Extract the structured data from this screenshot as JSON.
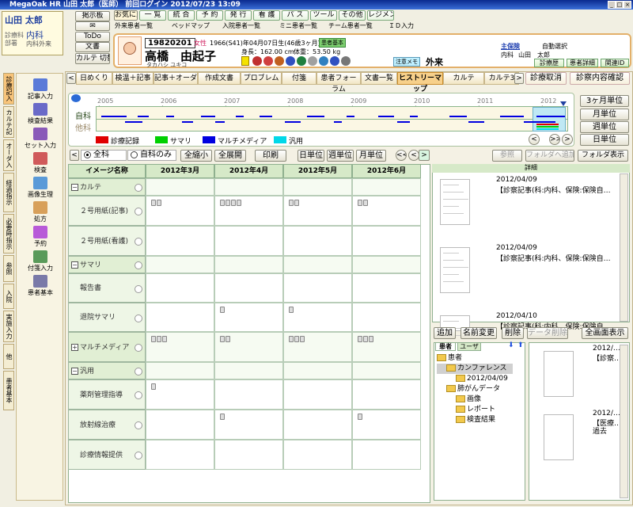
{
  "window": {
    "title": "MegaOak HR   山田 太郎（医師） 前回ログイン 2012/07/23 13:09"
  },
  "user": {
    "name": "山田 太郎",
    "role_label": "診療科",
    "role_value": "内科",
    "dept_label": "部署",
    "dept_value": "内科外来"
  },
  "top_buttons": {
    "board": "掲示板",
    "mail": "✉",
    "todo": "ToDo",
    "docs": "文書",
    "card_switch": "カルテ 切替"
  },
  "menu_tabs": [
    "お気に入",
    "一 覧",
    "統 合",
    "予 約",
    "発 行",
    "看 護",
    "パ ス",
    "ツール",
    "その他",
    "レジメン"
  ],
  "quick_links": [
    "外来患者一覧",
    "ベッドマップ",
    "入院患者一覧",
    "ミニ患者一覧",
    "チーム患者一覧",
    "ＩＤ入力"
  ],
  "patient": {
    "id": "19820201",
    "sex": "女性",
    "dob": "1966(S41)年04月07日生(46歳3ヶ月)",
    "badge": "患者基本",
    "name": "高橋　由起子",
    "kana": "タカハシ ユキコ",
    "height": "身長：162.00 cm",
    "weight": "体重：53.50 kg",
    "memo_label": "注意メモ",
    "visit": "外来"
  },
  "insurance": {
    "main": "主保険",
    "auto": "自動選択",
    "dept": "内科",
    "doctor": "山田　太郎",
    "btn_history": "診療歴",
    "btn_detail": "患者詳細",
    "btn_related": "関連ID"
  },
  "doc_tabs": [
    "日めくり",
    "検温＋記事",
    "記事＋オーダ",
    "作成文書",
    "プロブレム",
    "付箋",
    "患者フォーラム",
    "文書一覧",
    "ヒストリーマップ",
    "カルテ",
    "カルテ3"
  ],
  "doc_actions": {
    "cancel": "診療取消",
    "confirm": "診察内容確認"
  },
  "left_tabs": [
    "診療記入",
    "カルテ記事",
    "オーダ入力",
    "経過指示",
    "必要時指示",
    "参照",
    "入院",
    "実施入力",
    "他",
    "患者基本"
  ],
  "tools": [
    "記事入力",
    "検査結果",
    "セット入力",
    "検査",
    "画像生理",
    "処方",
    "予約",
    "付箋入力",
    "患者基本"
  ],
  "timeline": {
    "years": [
      "2005年",
      "2006年",
      "2007年",
      "2008年",
      "2009年",
      "2010年",
      "2011年",
      "2012年"
    ],
    "row_self": "自科",
    "row_other": "他科",
    "units": [
      "3ヶ月単位",
      "月単位",
      "週単位",
      "日単位"
    ]
  },
  "legend": [
    {
      "label": "診療記録",
      "color": "#e00000"
    },
    {
      "label": "サマリ",
      "color": "#00d000"
    },
    {
      "label": "マルチメディア",
      "color": "#0000e0"
    },
    {
      "label": "汎用",
      "color": "#00d8e8"
    }
  ],
  "filter": {
    "all": "全科",
    "self": "自科のみ",
    "collapse": "全縮小",
    "expand": "全展開",
    "print": "印刷",
    "day": "日単位",
    "week": "週単位",
    "month": "月単位"
  },
  "right_top": {
    "ref": "参照",
    "add_folder": "フォルダへ追加",
    "show_folder": "フォルダ表示",
    "detail": "詳細"
  },
  "grid": {
    "header_name": "イメージ名称",
    "months": [
      "2012年3月",
      "2012年4月",
      "2012年5月",
      "2012年6月"
    ],
    "rows": [
      {
        "label": "カルテ",
        "group": true,
        "mark": "−"
      },
      {
        "label": "２号用紙(記事)",
        "group": false
      },
      {
        "label": "２号用紙(看護)",
        "group": false
      },
      {
        "label": "サマリ",
        "group": true,
        "mark": "−"
      },
      {
        "label": "報告書",
        "group": false
      },
      {
        "label": "退院サマリ",
        "group": false
      },
      {
        "label": "マルチメディア",
        "group": true,
        "mark": "+"
      },
      {
        "label": "汎用",
        "group": true,
        "mark": "−"
      },
      {
        "label": "薬剤管理指導",
        "group": false
      },
      {
        "label": "放射線治療",
        "group": false
      },
      {
        "label": "診療情報提供",
        "group": false
      }
    ]
  },
  "details": [
    {
      "date": "2012/04/09",
      "text": "【診察記事(科:内科、保険:保険自…"
    },
    {
      "date": "2012/04/09",
      "text": "【診察記事(科:内科、保険:保険自…"
    },
    {
      "date": "2012/04/10",
      "text": "【診察記事(科:内科、保険:保険自…"
    }
  ],
  "folder_buttons": {
    "add": "追加",
    "rename": "名前変更",
    "delete": "削除",
    "data_delete": "データ削除",
    "fullscreen": "全画面表示"
  },
  "folder_tabs": {
    "patient": "患者",
    "user": "ユーザ"
  },
  "tree": {
    "root": "患者",
    "conf": "カンファレンス",
    "conf_date": "2012/04/09",
    "data": "肺がんデータ",
    "img": "画像",
    "report": "レポート",
    "lab": "検査結果"
  },
  "thumbs": [
    {
      "date": "2012/…",
      "text": "【診察…"
    },
    {
      "date": "2012/…",
      "text": "【医療…",
      "extra": "過去"
    }
  ]
}
